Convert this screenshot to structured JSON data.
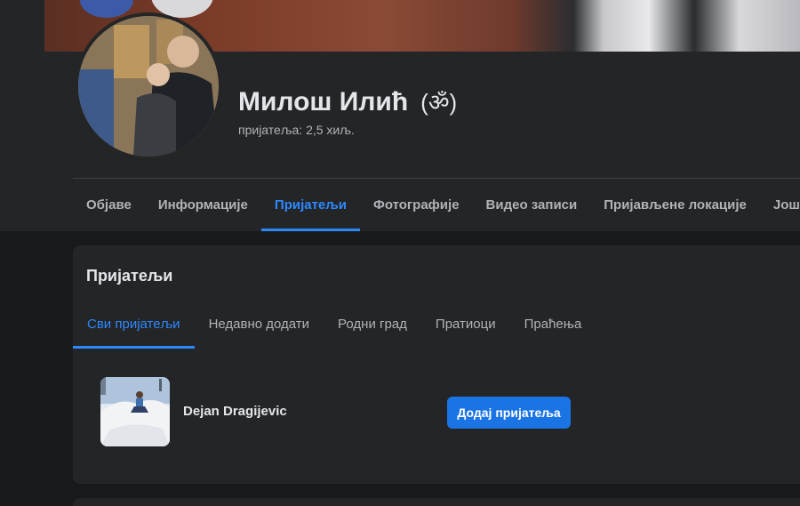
{
  "profile": {
    "name": "Милош Илић",
    "alternate_name": "(ॐ)",
    "friends_count": "пријатеља: 2,5 хиљ."
  },
  "tabs": [
    {
      "label": "Објаве"
    },
    {
      "label": "Информације"
    },
    {
      "label": "Пријатељи"
    },
    {
      "label": "Фотографије"
    },
    {
      "label": "Видео записи"
    },
    {
      "label": "Пријављене локације"
    },
    {
      "label": "Још"
    }
  ],
  "active_tab": "Пријатељи",
  "friends_section": {
    "title": "Пријатељи",
    "subtabs": [
      {
        "label": "Сви пријатељи"
      },
      {
        "label": "Недавно додати"
      },
      {
        "label": "Родни град"
      },
      {
        "label": "Пратиоци"
      },
      {
        "label": "Праћења"
      }
    ],
    "active_subtab": "Сви пријатељи",
    "friends": [
      {
        "name": "Dejan Dragijevic",
        "action_label": "Додај пријатеља"
      }
    ]
  },
  "colors": {
    "background": "#18191a",
    "surface": "#242526",
    "accent": "#2d88ff",
    "button": "#1b74e4",
    "text_primary": "#e4e6eb",
    "text_secondary": "#b0b3b8"
  },
  "icons": {
    "more_tab": "caret-down-icon"
  }
}
